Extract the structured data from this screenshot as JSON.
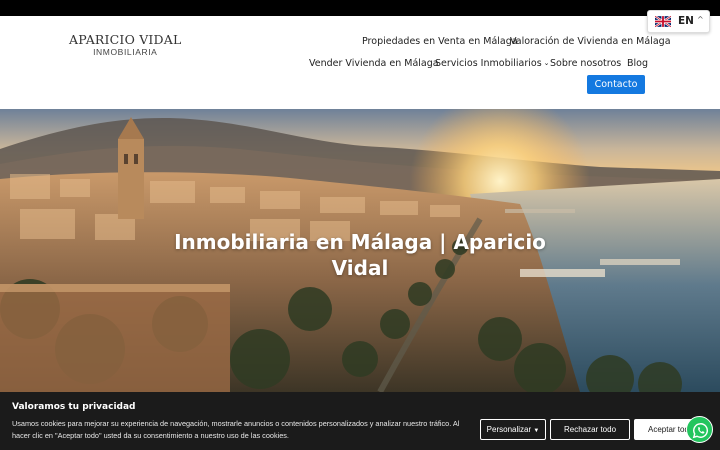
{
  "logo": {
    "main": "APARICIO VIDAL",
    "sub": "INMOBILIARIA"
  },
  "nav": {
    "row1": [
      "Propiedades en Venta en Málaga",
      "Valoración de Vivienda en Málaga"
    ],
    "row2": [
      "Vender Vivienda en Málaga",
      "Servicios Inmobiliarios",
      "Sobre nosotros",
      "Blog"
    ],
    "contact": "Contacto",
    "dropdown_icon": "chevron-down-icon"
  },
  "language": {
    "code": "EN",
    "caret": "^",
    "flag_icon": "uk-flag-icon"
  },
  "hero": {
    "title": "Inmobiliaria en Málaga | Aparicio Vidal"
  },
  "cookie": {
    "title": "Valoramos tu privacidad",
    "text": "Usamos cookies para mejorar su experiencia de navegación, mostrarle anuncios o contenidos personalizados y analizar nuestro tráfico. Al hacer clic en \"Aceptar todo\" usted da su consentimiento a nuestro uso de las cookies.",
    "customize": "Personalizar",
    "reject": "Rechazar todo",
    "accept": "Aceptar todo"
  },
  "colors": {
    "accent": "#1479e0",
    "cookie_bg": "#1b1b1b",
    "whatsapp": "#23c55e"
  }
}
